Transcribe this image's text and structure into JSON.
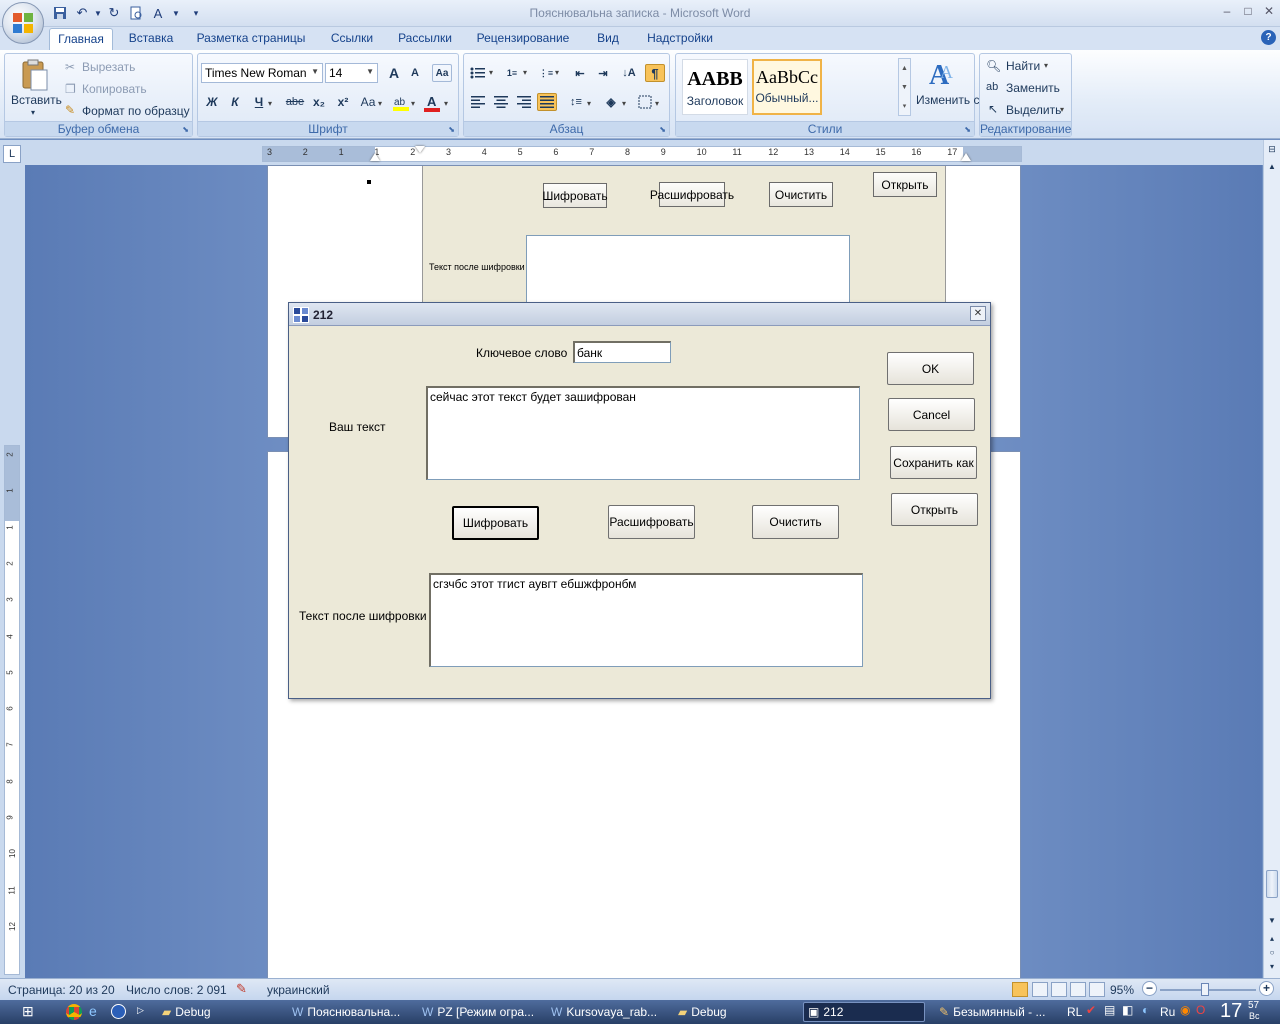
{
  "window": {
    "title": "Пояснювальна записка - Microsoft Word"
  },
  "tabs": [
    "Главная",
    "Вставка",
    "Разметка страницы",
    "Ссылки",
    "Рассылки",
    "Рецензирование",
    "Вид",
    "Надстройки"
  ],
  "ribbon": {
    "clipboard": {
      "paste": "Вставить",
      "cut": "Вырезать",
      "copy": "Копировать",
      "format_painter": "Формат по образцу",
      "label": "Буфер обмена"
    },
    "font": {
      "name": "Times New Roman",
      "size": "14",
      "label": "Шрифт",
      "bold": "Ж",
      "italic": "К",
      "underline": "Ч",
      "strike": "abe",
      "subscript": "x₂",
      "superscript": "x²",
      "case": "Аа",
      "grow": "A",
      "shrink": "A"
    },
    "paragraph": {
      "label": "Абзац"
    },
    "styles": {
      "heading": "Заголовок",
      "heading_sample": "AABB",
      "normal": "Обычный...",
      "normal_sample": "AaBbCc",
      "change": "Изменить стили",
      "label": "Стили"
    },
    "editing": {
      "find": "Найти",
      "replace": "Заменить",
      "select": "Выделить",
      "label": "Редактирование"
    }
  },
  "ruler": {
    "h_labels": [
      "3",
      "2",
      "1",
      "1",
      "2",
      "3",
      "4",
      "5",
      "6",
      "7",
      "8",
      "9",
      "10",
      "11",
      "12",
      "13",
      "14",
      "15",
      "16",
      "17"
    ],
    "v_labels": [
      "2",
      "1",
      "1",
      "2",
      "3",
      "4",
      "5",
      "6",
      "7",
      "8",
      "9",
      "10",
      "11",
      "12"
    ]
  },
  "embedded": {
    "encrypt": "Шифровать",
    "decrypt": "Расшифровать",
    "clear": "Очистить",
    "open": "Открыть",
    "after_label": "Текст после шифровки"
  },
  "dialog": {
    "title": "212",
    "keyword_label": "Ключевое слово",
    "keyword_value": "банк",
    "your_text_label": "Ваш текст",
    "your_text_value": "сейчас этот текст будет зашифрован",
    "after_label": "Текст после шифровки",
    "after_value": "сгзчбс этот тгист аувгт ебшжфронбм",
    "ok": "OK",
    "cancel": "Cancel",
    "save_as": "Сохранить как",
    "open": "Открыть",
    "encrypt": "Шифровать",
    "decrypt": "Расшифровать",
    "clear": "Очистить"
  },
  "status": {
    "page": "Страница: 20 из 20",
    "words": "Число слов: 2 091",
    "lang": "украинский",
    "zoom": "95%"
  },
  "taskbar": {
    "items": [
      "Debug",
      "Пояснювальна...",
      "PZ [Режим огра...",
      "Kursovaya_rab...",
      "Debug",
      "212",
      "Безымянный - ..."
    ],
    "lang": "RL",
    "layout": "Ru",
    "clock": "17",
    "clock_min": "57",
    "clock_day": "Вс"
  }
}
